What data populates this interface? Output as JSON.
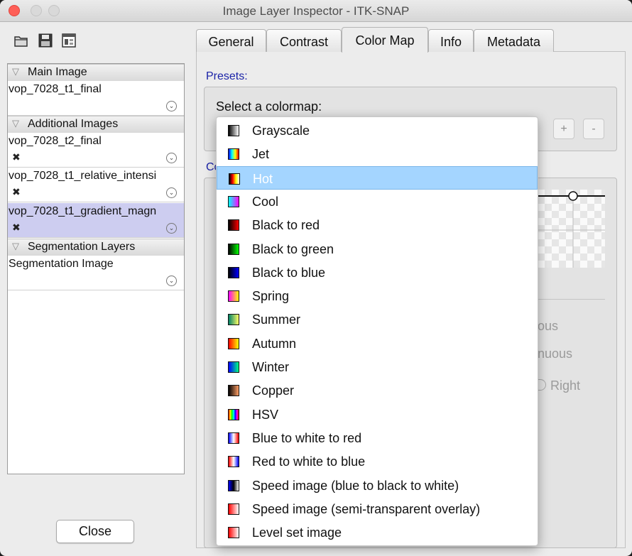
{
  "window": {
    "title": "Image Layer Inspector - ITK-SNAP"
  },
  "toolbar": {
    "icons": [
      "open-folder-icon",
      "save-icon",
      "layout-icon"
    ]
  },
  "groups": {
    "main": "Main Image",
    "additional": "Additional Images",
    "segmentation": "Segmentation Layers"
  },
  "layers": [
    {
      "name": "vop_7028_t1_final"
    },
    {
      "name": "vop_7028_t2_final"
    },
    {
      "name": "vop_7028_t1_relative_intensi"
    },
    {
      "name": "vop_7028_t1_gradient_magn"
    },
    {
      "name": "Segmentation Image"
    }
  ],
  "close_label": "Close",
  "tabs": [
    "General",
    "Contrast",
    "Color Map",
    "Info",
    "Metadata"
  ],
  "active_tab": "Color Map",
  "presets": {
    "label": "Presets:",
    "select_label": "Select a colormap:",
    "add_label": "+",
    "remove_label": "-"
  },
  "partial_texts": {
    "section": "Co",
    "p1": "ous",
    "p2": "nuous",
    "p3": "Right"
  },
  "dropdown": {
    "selected": "Hot",
    "options": [
      {
        "label": "Grayscale",
        "colors": [
          "#000000",
          "#ffffff"
        ]
      },
      {
        "label": "Jet",
        "colors": [
          "#0000ff",
          "#00ffff",
          "#ffff00",
          "#ff0000"
        ]
      },
      {
        "label": "Hot",
        "colors": [
          "#000000",
          "#ff0000",
          "#ffff00",
          "#ffffff"
        ]
      },
      {
        "label": "Cool",
        "colors": [
          "#00ffff",
          "#ff00ff"
        ]
      },
      {
        "label": "Black to red",
        "colors": [
          "#000000",
          "#ff0000"
        ]
      },
      {
        "label": "Black to green",
        "colors": [
          "#000000",
          "#00ff00"
        ]
      },
      {
        "label": "Black to blue",
        "colors": [
          "#000000",
          "#0000ff"
        ]
      },
      {
        "label": "Spring",
        "colors": [
          "#ff00ff",
          "#ffff00"
        ]
      },
      {
        "label": "Summer",
        "colors": [
          "#008066",
          "#ffff66"
        ]
      },
      {
        "label": "Autumn",
        "colors": [
          "#ff0000",
          "#ffff00"
        ]
      },
      {
        "label": "Winter",
        "colors": [
          "#0000ff",
          "#00ff80"
        ]
      },
      {
        "label": "Copper",
        "colors": [
          "#000000",
          "#ff9f66"
        ]
      },
      {
        "label": "HSV",
        "colors": [
          "#ff0000",
          "#ffff00",
          "#00ff00",
          "#00ffff",
          "#0000ff",
          "#ff00ff",
          "#ff0000"
        ]
      },
      {
        "label": "Blue to white to red",
        "colors": [
          "#0000ff",
          "#ffffff",
          "#ff0000"
        ]
      },
      {
        "label": "Red to white to blue",
        "colors": [
          "#ff0000",
          "#ffffff",
          "#0000ff"
        ]
      },
      {
        "label": "Speed image (blue to black to white)",
        "colors": [
          "#0000ff",
          "#000000",
          "#ffffff"
        ]
      },
      {
        "label": "Speed image (semi-transparent overlay)",
        "colors": [
          "#ff0000",
          "#ffffff"
        ]
      },
      {
        "label": "Level set image",
        "colors": [
          "#ff0000",
          "#ffffff"
        ]
      }
    ]
  }
}
